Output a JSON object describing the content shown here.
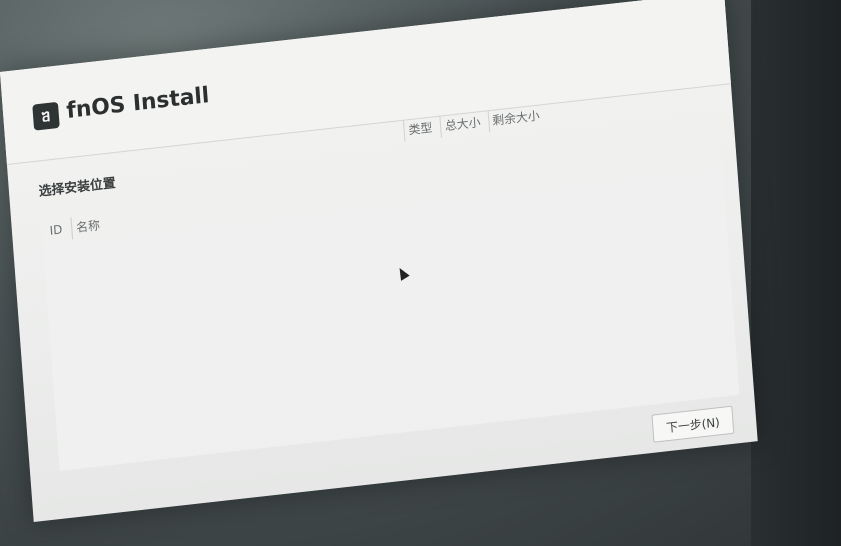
{
  "app": {
    "title": "fnOS Install",
    "logo_icon": "fnos-logo-icon"
  },
  "install_location": {
    "section_title": "选择安装位置",
    "table": {
      "columns": {
        "id": "ID",
        "name": "名称",
        "type": "类型",
        "total_size": "总大小",
        "free_size": "剩余大小"
      },
      "rows": []
    }
  },
  "footer": {
    "next_button_label": "下一步(N)"
  },
  "colors": {
    "background": "#ecedec",
    "text": "#2b2f30"
  }
}
